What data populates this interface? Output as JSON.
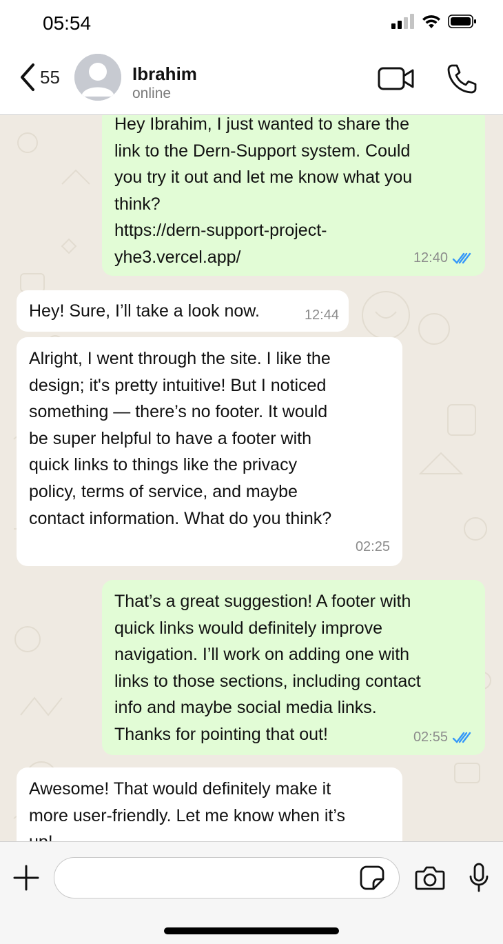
{
  "status_bar": {
    "time": "05:54"
  },
  "header": {
    "back_count": "55",
    "contact_name": "Ibrahim",
    "contact_status": "online"
  },
  "messages": [
    {
      "direction": "out",
      "text": "Hey Ibrahim, I just wanted to share the\nlink to the Dern-Support system. Could\nyou try it out and let me know what you\nthink?\nhttps://dern-support-project-\nyhe3.vercel.app/",
      "time": "12:40",
      "status": "read"
    },
    {
      "direction": "in",
      "text": "Hey! Sure, I’ll take a look now.",
      "time": "12:44"
    },
    {
      "direction": "in",
      "text": "Alright, I went through the site. I like the\ndesign; it's pretty intuitive! But I noticed\nsomething — there’s no footer. It would\nbe super helpful to have a footer with\nquick links to things like the privacy\npolicy, terms of service, and maybe\ncontact information. What do you think?",
      "time": "02:25"
    },
    {
      "direction": "out",
      "text": "That’s a great suggestion! A footer with\nquick links would definitely improve\nnavigation. I’ll work on adding one with\nlinks to those sections, including contact\ninfo and maybe social media links.\nThanks for pointing that out!",
      "time": "02:55",
      "status": "read"
    },
    {
      "direction": "in",
      "text": "Awesome! That would definitely make it\nmore user-friendly. Let me know when it’s\nup!",
      "time": ""
    }
  ],
  "composer": {
    "placeholder": ""
  },
  "colors": {
    "outgoing_bubble": "#e2fcd6",
    "incoming_bubble": "#ffffff",
    "chat_background": "#efeae2",
    "read_ticks": "#3497f9"
  },
  "icons": [
    "back-chevron-icon",
    "avatar-placeholder-icon",
    "video-call-icon",
    "phone-icon",
    "plus-icon",
    "sticker-icon",
    "camera-icon",
    "microphone-icon",
    "double-check-icon",
    "signal-icon",
    "wifi-icon",
    "battery-icon"
  ]
}
